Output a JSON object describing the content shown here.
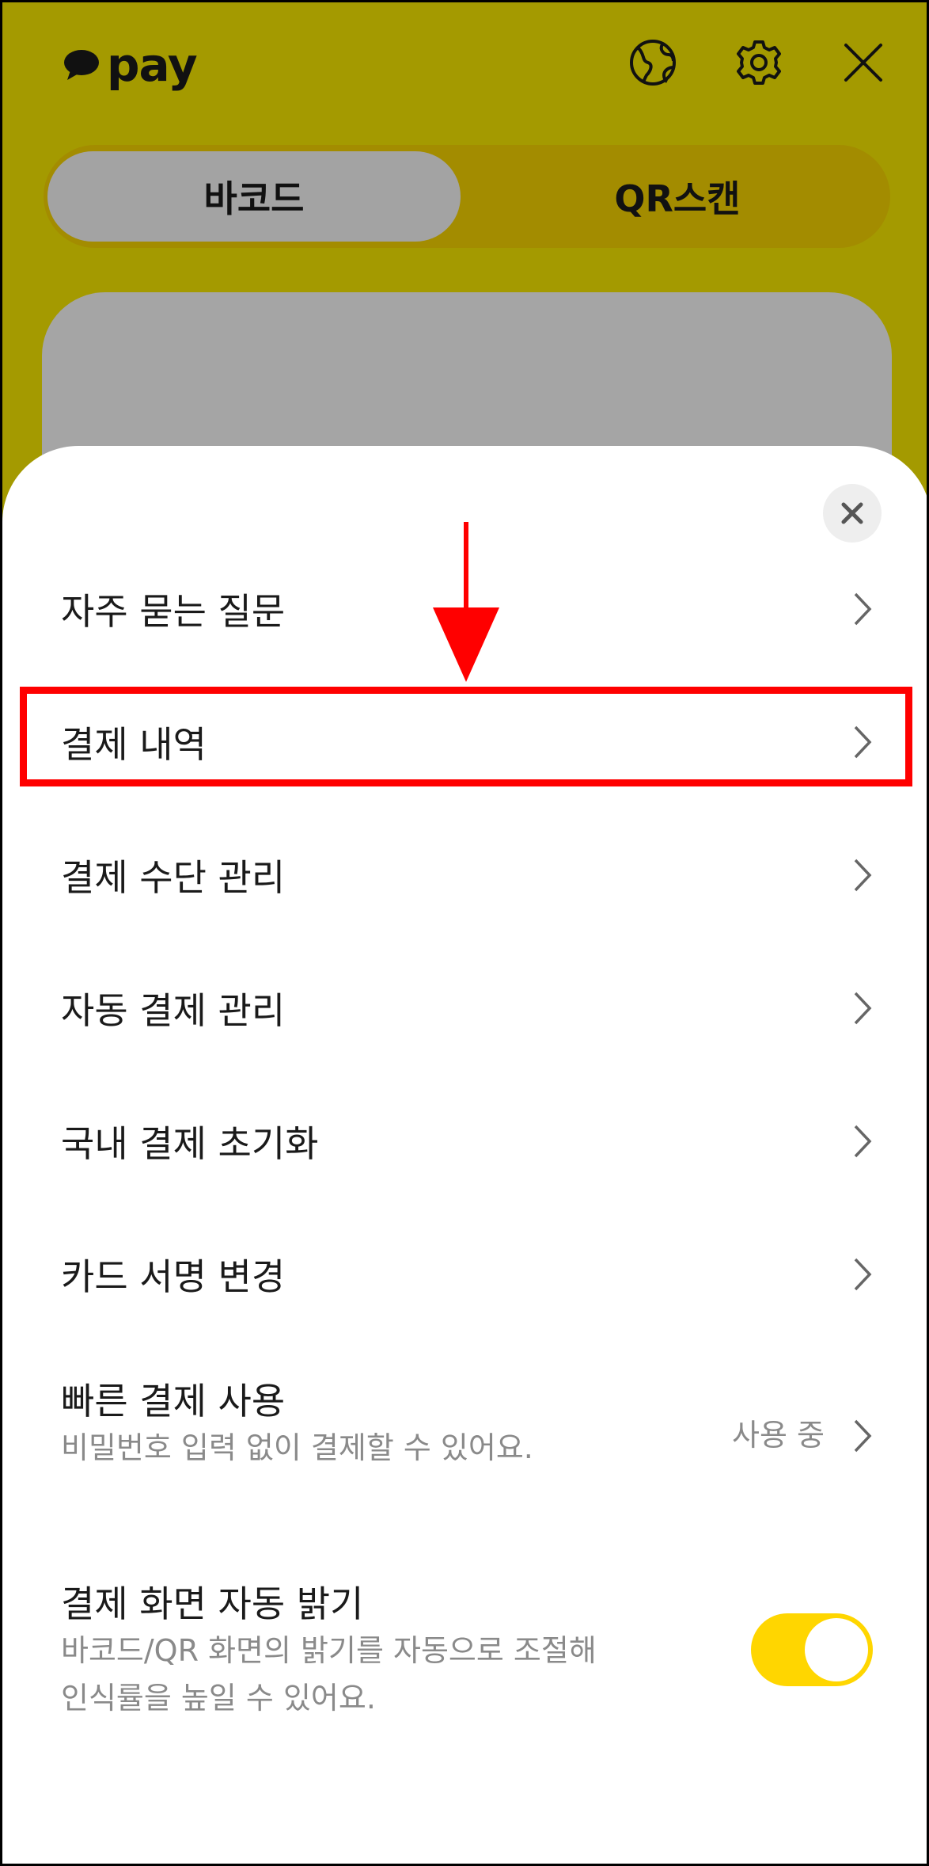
{
  "header": {
    "logo_text": "pay",
    "icons": [
      "globe-icon",
      "gear-icon",
      "close-icon"
    ]
  },
  "tabs": [
    {
      "label": "바코드",
      "selected": true
    },
    {
      "label": "QR스캔",
      "selected": false
    }
  ],
  "sheet": {
    "menu": [
      {
        "label": "자주 묻는 질문"
      },
      {
        "label": "결제 내역",
        "highlighted": true
      },
      {
        "label": "결제 수단 관리"
      },
      {
        "label": "자동 결제 관리"
      },
      {
        "label": "국내 결제 초기화"
      },
      {
        "label": "카드 서명 변경"
      }
    ],
    "quick_pay": {
      "label": "빠른 결제 사용",
      "description": "비밀번호 입력 없이 결제할 수 있어요.",
      "status": "사용 중"
    },
    "auto_brightness": {
      "label": "결제 화면 자동 밝기",
      "description_line1": "바코드/QR 화면의 밝기를 자동으로 조절해",
      "description_line2": "인식률을 높일 수 있어요.",
      "enabled": true
    }
  },
  "colors": {
    "header_bg": "#a49a00",
    "toggle_on": "#ffd600",
    "annotation": "#ff0000"
  }
}
